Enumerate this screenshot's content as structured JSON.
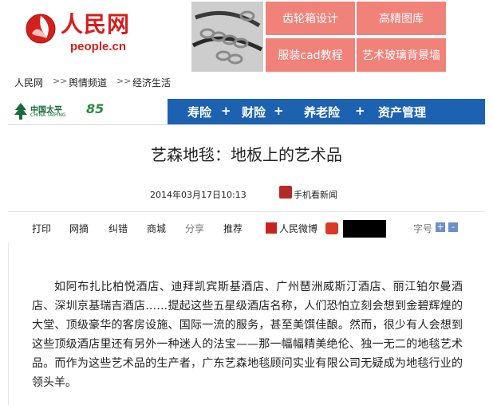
{
  "header": {
    "logo_text": "人民网",
    "logo_domain": "people.cn",
    "logo_color": "#d4201c"
  },
  "ads": {
    "items": [
      {
        "label": "齿轮箱设计"
      },
      {
        "label": "高精图库"
      },
      {
        "label": "服装cad教程"
      },
      {
        "label": "艺术玻璃背景墙"
      }
    ],
    "color": "#f0827a"
  },
  "breadcrumb": {
    "items": [
      "人民网",
      "舆情频道",
      "经济生活"
    ],
    "separator": ">>"
  },
  "banner": {
    "brand_zh": "中国太平",
    "brand_en": "CHINA TAIPING",
    "anniversary": "85",
    "items": [
      "寿险",
      "财险",
      "养老险",
      "资产管理"
    ],
    "separator": "+",
    "color": "#1d62b0"
  },
  "article": {
    "title": "艺森地毯：地板上的艺术品",
    "date": "2014年03月17日10:13",
    "mobile_news": "手机看新闻",
    "body": "如阿布扎比柏悦酒店、迪拜凯宾斯基酒店、广州琶洲威斯汀酒店、丽江铂尔曼酒店、深圳京基瑞吉酒店……提起这些五星级酒店名称，人们恐怕立刻会想到金碧辉煌的大堂、顶级豪华的客房设施、国际一流的服务，甚至美馔佳酿。然而，很少有人会想到这些顶级酒店里还有另外一种迷人的法宝——那一幅幅精美绝伦、独一无二的地毯艺术品。而作为这些艺术品的生产者，广东艺森地毯顾问实业有限公司无疑成为地毯行业的领头羊。"
  },
  "toolbar": {
    "print": "打印",
    "bookmark": "网摘",
    "correct": "纠错",
    "business": "商城",
    "share": "分享",
    "recommend": "推荐",
    "weibo": "人民微博",
    "font_size": "字号",
    "font_plus": "+",
    "font_minus": "-"
  }
}
